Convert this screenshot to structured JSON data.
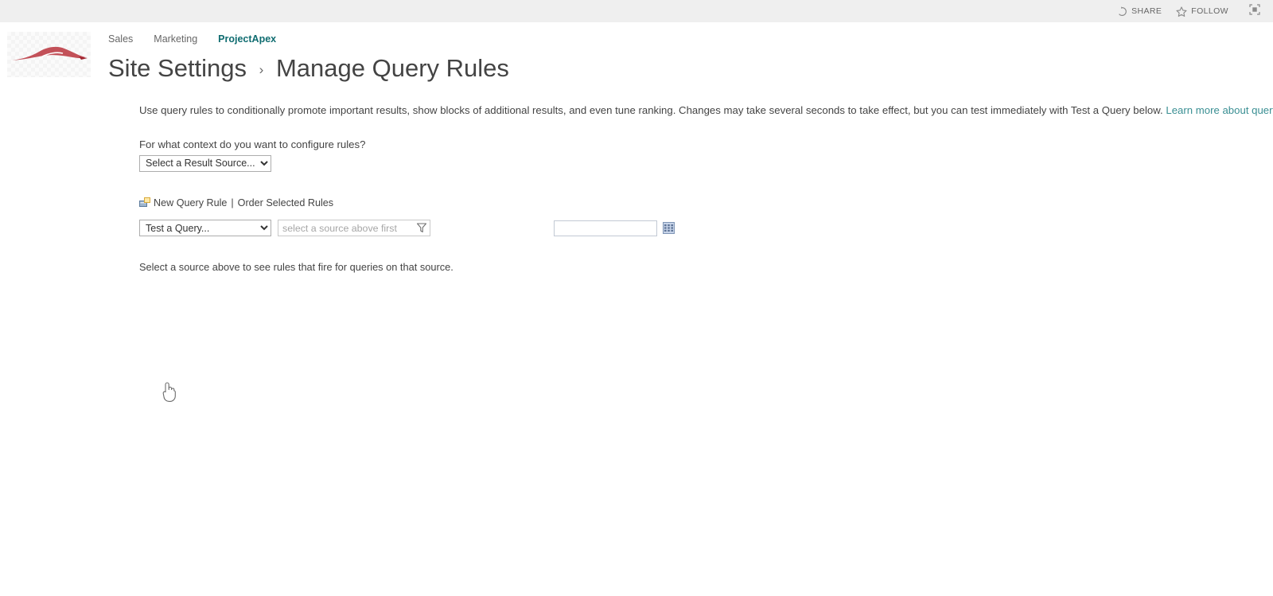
{
  "suitebar": {
    "share_label": "SHARE",
    "follow_label": "FOLLOW",
    "share_icon": "share-icon",
    "follow_icon": "star-icon",
    "focus_icon": "focus-on-content-icon"
  },
  "header": {
    "logo_icon": "site-logo-car",
    "breadcrumb": [
      {
        "label": "Sales",
        "current": false
      },
      {
        "label": "Marketing",
        "current": false
      },
      {
        "label": "ProjectApex",
        "current": true
      }
    ],
    "title_parent": "Site Settings",
    "title_separator": "›",
    "title_current": "Manage Query Rules"
  },
  "main": {
    "description_before_link": "Use query rules to conditionally promote important results, show blocks of additional results, and even tune ranking. Changes may take several seconds to take effect, but you can test immediately with Test a Query below. ",
    "description_link": "Learn more about query rules.",
    "context_label": "For what context do you want to configure rules?",
    "result_source_select": {
      "selected": "Select a Result Source...",
      "options": [
        "Select a Result Source..."
      ]
    },
    "toolbar": {
      "new_icon": "new-query-rule-icon",
      "new_query_rule": "New Query Rule",
      "separator": "|",
      "order_selected_rules": "Order Selected Rules"
    },
    "test_query_select": {
      "selected": "Test a Query...",
      "options": [
        "Test a Query..."
      ]
    },
    "source_field": {
      "placeholder": "select a source above first",
      "value": "",
      "icon": "funnel-filter-icon"
    },
    "query_input": {
      "value": "",
      "placeholder": ""
    },
    "picker_icon": "grid-picker-icon",
    "hint": "Select a source above to see rules that fire for queries on that source."
  },
  "cursor": {
    "type": "pointer-hand"
  },
  "colors": {
    "accent_link": "#3a8f93",
    "breadcrumb_current": "#0f6c70",
    "suitebar_bg": "#efefef",
    "text": "#444444",
    "logo_red": "#b8323c"
  }
}
